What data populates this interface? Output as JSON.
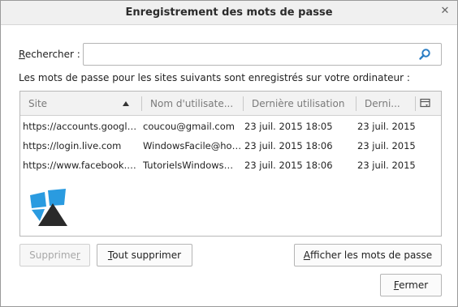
{
  "window": {
    "title": "Enregistrement des mots de passe",
    "close_glyph": "✕"
  },
  "search": {
    "label_underlined": "R",
    "label_rest": "echercher :",
    "value": "",
    "placeholder": ""
  },
  "info_text": "Les mots de passe pour les sites suivants sont enregistrés sur votre ordinateur :",
  "table": {
    "columns": [
      "Site",
      "Nom d'utilisate...",
      "Dernière utilisation",
      "Derni..."
    ],
    "rows": [
      [
        "https://accounts.google....",
        "coucou@gmail.com",
        "23 juil. 2015 18:05",
        "23 juil. 2015"
      ],
      [
        "https://login.live.com",
        "WindowsFacile@hot...",
        "23 juil. 2015 18:06",
        "23 juil. 2015"
      ],
      [
        "https://www.facebook.co...",
        "TutorielsWindows@...",
        "23 juil. 2015 18:06",
        "23 juil. 2015"
      ]
    ]
  },
  "buttons": {
    "delete": {
      "ak": "r",
      "pre": "Supprime",
      "post": ""
    },
    "delete_all": {
      "ak": "T",
      "pre": "",
      "post": "out supprimer"
    },
    "show_passwords": {
      "ak": "A",
      "pre": "",
      "post": "fficher les mots de passe"
    },
    "close": {
      "ak": "F",
      "pre": "",
      "post": "ermer"
    }
  },
  "colors": {
    "logo_blue": "#2a9be0",
    "logo_dark": "#2a2a2a"
  },
  "icons": [
    "close-icon",
    "search-icon",
    "sort-ascending-icon",
    "column-picker-icon",
    "watermark-logo-icon"
  ]
}
